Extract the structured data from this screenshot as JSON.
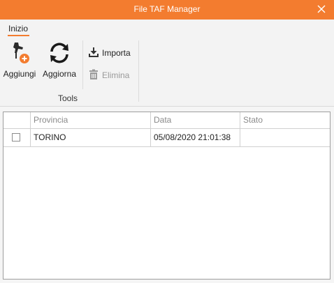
{
  "window": {
    "title": "File TAF Manager",
    "close_icon": "close-icon",
    "accent": "#f37c2f"
  },
  "ribbon": {
    "tab_label": "Inizio",
    "aggiungi_label": "Aggiungi",
    "aggiorna_label": "Aggiorna",
    "importa_label": "Importa",
    "elimina_label": "Elimina",
    "group_label": "Tools",
    "icons": {
      "aggiungi": "drill-add-icon",
      "aggiorna": "refresh-icon",
      "importa": "download-icon",
      "elimina": "trash-icon"
    }
  },
  "grid": {
    "columns": [
      "",
      "Provincia",
      "Data",
      "Stato"
    ],
    "rows": [
      {
        "checked": false,
        "provincia": "TORINO",
        "data": "05/08/2020 21:01:38",
        "stato": ""
      }
    ]
  }
}
